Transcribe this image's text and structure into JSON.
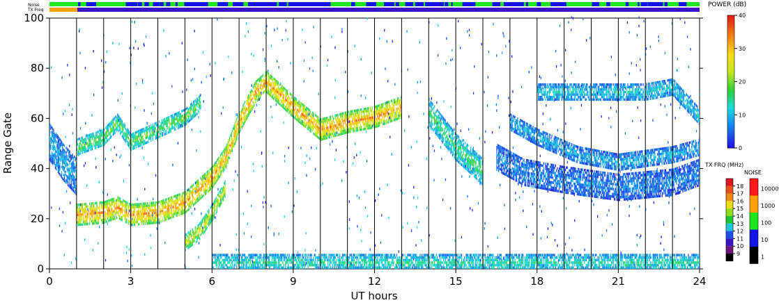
{
  "top_strips": {
    "noise_label": "Noise",
    "txfreq_label": "TX Freq"
  },
  "chart_data": {
    "type": "heatmap",
    "xlabel": "UT hours",
    "ylabel": "Range Gate",
    "xlim": [
      0,
      24
    ],
    "ylim": [
      0,
      100
    ],
    "x_ticks": [
      "0",
      "3",
      "6",
      "9",
      "12",
      "15",
      "18",
      "21",
      "24"
    ],
    "y_ticks": [
      "0",
      "20",
      "40",
      "60",
      "80",
      "100"
    ],
    "grid": "vertical lines every 1 hour",
    "bands": [
      {
        "name": "main echo band",
        "points": [
          [
            1.0,
            21
          ],
          [
            2.0,
            22
          ],
          [
            2.5,
            24
          ],
          [
            3.0,
            21
          ],
          [
            4.0,
            22
          ],
          [
            5.0,
            26
          ],
          [
            5.5,
            31
          ],
          [
            6.0,
            36
          ],
          [
            6.5,
            44
          ],
          [
            7.0,
            58
          ],
          [
            7.6,
            70
          ],
          [
            8.0,
            74
          ],
          [
            9.0,
            64
          ],
          [
            10.0,
            55
          ],
          [
            11.0,
            58
          ],
          [
            12.0,
            60
          ],
          [
            13.0,
            64
          ]
        ],
        "width": 8,
        "power": 28
      },
      {
        "name": "upper band 1-5 UT",
        "points": [
          [
            1.0,
            48
          ],
          [
            2.0,
            52
          ],
          [
            2.5,
            58
          ],
          [
            3.0,
            50
          ],
          [
            4.0,
            55
          ],
          [
            5.0,
            60
          ],
          [
            5.6,
            66
          ]
        ],
        "width": 6,
        "power": 16
      },
      {
        "name": "early band 0-1 UT",
        "points": [
          [
            0.0,
            50
          ],
          [
            0.5,
            42
          ],
          [
            1.0,
            36
          ]
        ],
        "width": 14,
        "power": 8
      },
      {
        "name": "low arc 5-6.5 UT",
        "points": [
          [
            5.0,
            10
          ],
          [
            5.5,
            14
          ],
          [
            6.0,
            22
          ],
          [
            6.5,
            32
          ]
        ],
        "width": 6,
        "power": 22
      },
      {
        "name": "slope 14-16 UT",
        "points": [
          [
            14.0,
            62
          ],
          [
            15.0,
            48
          ],
          [
            16.0,
            38
          ]
        ],
        "width": 10,
        "power": 14
      },
      {
        "name": "band 17-24 UT lower",
        "points": [
          [
            16.5,
            44
          ],
          [
            17.5,
            38
          ],
          [
            19.0,
            35
          ],
          [
            21.0,
            32
          ],
          [
            23.0,
            34
          ],
          [
            24.0,
            38
          ]
        ],
        "width": 10,
        "power": 6
      },
      {
        "name": "band 17-24 UT middle",
        "points": [
          [
            17.0,
            58
          ],
          [
            18.0,
            52
          ],
          [
            19.5,
            45
          ],
          [
            21.0,
            42
          ],
          [
            23.0,
            45
          ],
          [
            24.0,
            48
          ]
        ],
        "width": 6,
        "power": 8
      },
      {
        "name": "band 17-24 UT upper",
        "points": [
          [
            18.0,
            70
          ],
          [
            20.0,
            70
          ],
          [
            22.0,
            70
          ],
          [
            23.0,
            72
          ],
          [
            24.0,
            60
          ]
        ],
        "width": 6,
        "power": 10
      },
      {
        "name": "ground scatter",
        "points": [
          [
            6.0,
            2
          ],
          [
            12.0,
            2
          ],
          [
            18.0,
            2
          ],
          [
            24.0,
            2
          ]
        ],
        "width": 6,
        "power": 12
      }
    ],
    "power_scale": {
      "title": "POWER (dB)",
      "min": 0,
      "max": 40,
      "ticks": [
        "40",
        "30",
        "20",
        "10",
        "0"
      ]
    },
    "freq_scale": {
      "title": "TX FRQ (MHz)",
      "ticks": [
        "18",
        "17",
        "16",
        "15",
        "14",
        "13",
        "12",
        "11",
        "10",
        "9"
      ],
      "colors": [
        "#e0141c",
        "#e8501e",
        "#f08c14",
        "#f0dc14",
        "#90dc1e",
        "#1ec832",
        "#1ec8dc",
        "#2050f0",
        "#3c14c8",
        "#6e1478",
        "#000000"
      ]
    },
    "noise_scale": {
      "title": "NOISE",
      "ticks": [
        "10000",
        "1000",
        "100",
        "10",
        "1"
      ],
      "colors": [
        "#ff1818",
        "#ffa000",
        "#1ee61e",
        "#1414e6",
        "#000000"
      ]
    }
  }
}
